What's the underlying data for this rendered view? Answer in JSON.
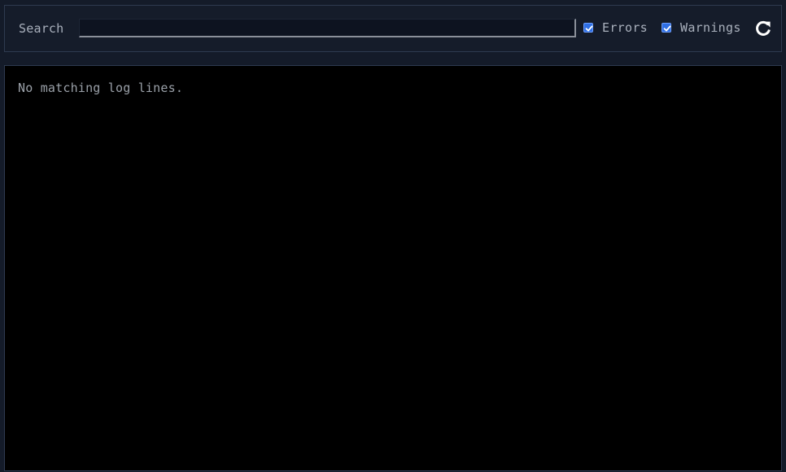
{
  "toolbar": {
    "search_label": "Search",
    "search_value": "",
    "search_placeholder": "",
    "filters": [
      {
        "label": "Errors",
        "checked": true
      },
      {
        "label": "Warnings",
        "checked": true
      }
    ],
    "refresh_icon": "refresh-icon"
  },
  "log": {
    "empty_message": "No matching log lines."
  },
  "colors": {
    "background": "#141b29",
    "log_background": "#000000",
    "checkbox_accent": "#2f6fe4",
    "text": "#a9b0bc"
  }
}
